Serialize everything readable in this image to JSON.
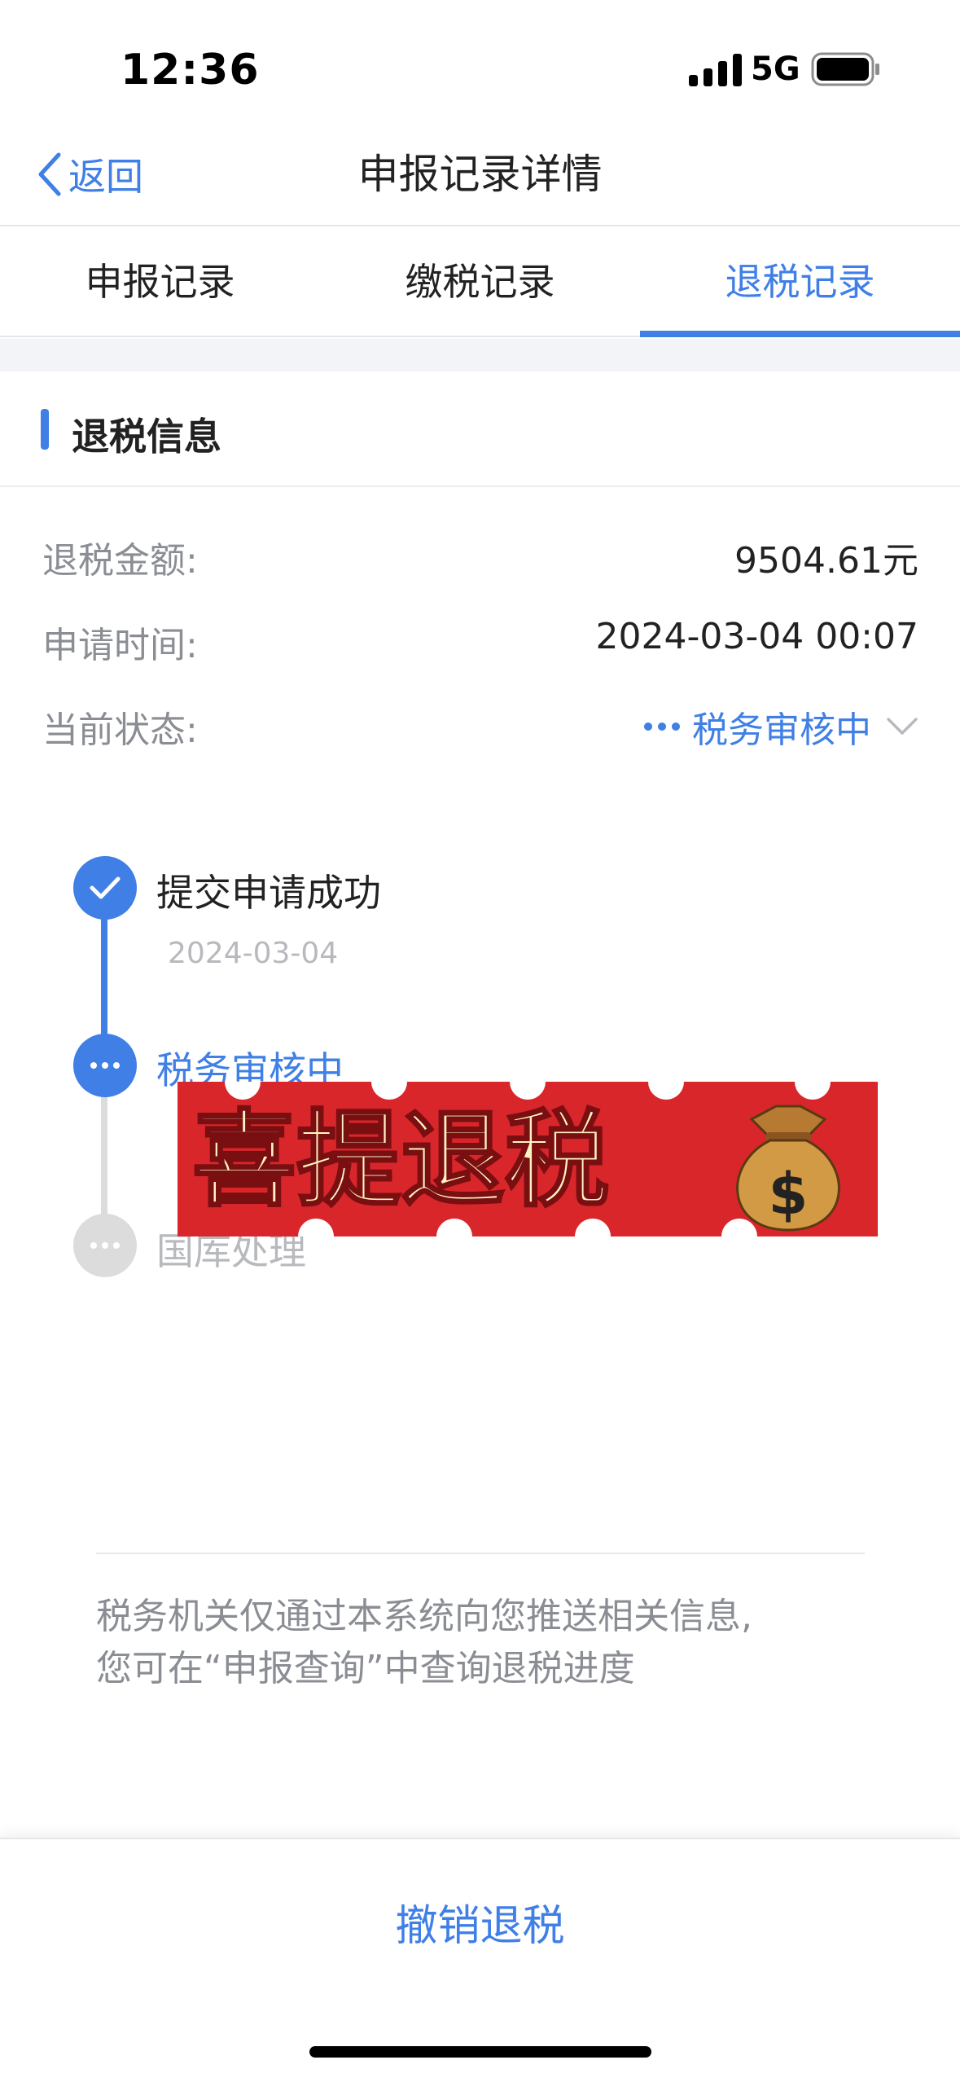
{
  "status_bar": {
    "time": "12:36",
    "network": "5G"
  },
  "nav": {
    "back_label": "返回",
    "title": "申报记录详情"
  },
  "tabs": [
    {
      "label": "申报记录",
      "active": false
    },
    {
      "label": "缴税记录",
      "active": false
    },
    {
      "label": "退税记录",
      "active": true
    }
  ],
  "section": {
    "title": "退税信息"
  },
  "info": {
    "amount_label": "退税金额:",
    "amount_value": "9504.61元",
    "apply_time_label": "申请时间:",
    "apply_time_value": "2024-03-04 00:07",
    "status_label": "当前状态:",
    "status_value": "税务审核中"
  },
  "timeline": [
    {
      "title": "提交申请成功",
      "date": "2024-03-04",
      "state": "done"
    },
    {
      "title": "税务审核中",
      "date": "",
      "state": "current"
    },
    {
      "title": "国库处理",
      "date": "",
      "state": "pending"
    }
  ],
  "sticker": {
    "text": "喜提退税",
    "icon": "money-bag-icon"
  },
  "note": {
    "line1": "税务机关仅通过本系统向您推送相关信息,",
    "line2": "您可在“申报查询”中查询退税进度"
  },
  "bottom": {
    "cancel_label": "撤销退税"
  },
  "colors": {
    "accent": "#3f7fe6",
    "muted": "#8a8d93",
    "pending": "#dcdcdc",
    "sticker_red": "#d9262b",
    "sticker_text": "#fff3c4"
  }
}
